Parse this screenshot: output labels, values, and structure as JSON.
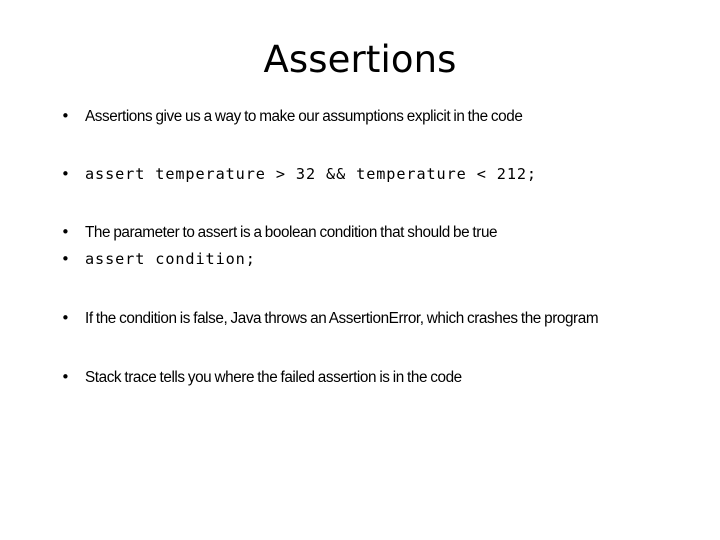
{
  "slide": {
    "title": "Assertions",
    "background_color": "#ffffff",
    "text_color": "#000000",
    "bullet_glyph": "•",
    "bullets": [
      {
        "style": "prose",
        "text": "Assertions give us a way to make our assumptions explicit in the code",
        "spacing": "first"
      },
      {
        "style": "code",
        "text": "assert temperature > 32 && temperature < 212;",
        "spacing": "large"
      },
      {
        "style": "prose",
        "text": "The parameter to assert is a boolean condition that should be true",
        "spacing": "large"
      },
      {
        "style": "code",
        "text": "assert condition;",
        "spacing": "small"
      },
      {
        "style": "prose",
        "text": "If the condition is false, Java throws an AssertionError, which crashes the program",
        "spacing": "xlarge"
      },
      {
        "style": "prose",
        "text": "Stack trace tells you where the failed assertion is in the code",
        "spacing": "xlarge"
      }
    ]
  }
}
